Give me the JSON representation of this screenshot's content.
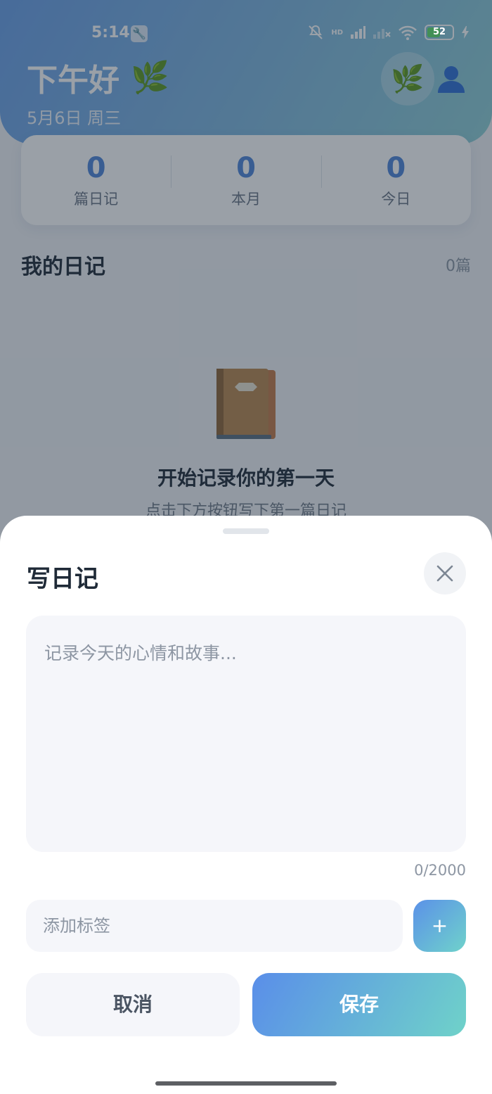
{
  "status_bar": {
    "time": "5:14",
    "hd_label": "HD",
    "battery": "52",
    "icons": [
      "wrench-icon",
      "mute-icon",
      "signal-icon",
      "no-signal-icon",
      "wifi-icon",
      "battery-icon",
      "charging-icon"
    ]
  },
  "header": {
    "greeting": "下午好",
    "greeting_emoji": "🌿",
    "date": "5月6日 周三",
    "leaf_button_emoji": "🌿",
    "profile_icon": "person-icon"
  },
  "stats": [
    {
      "value": "0",
      "label": "篇日记"
    },
    {
      "value": "0",
      "label": "本月"
    },
    {
      "value": "0",
      "label": "今日"
    }
  ],
  "diary_list": {
    "title": "我的日记",
    "count": "0篇",
    "empty_title": "开始记录你的第一天",
    "empty_subtitle": "点击下方按钮写下第一篇日记"
  },
  "sheet": {
    "title": "写日记",
    "textarea_placeholder": "记录今天的心情和故事...",
    "textarea_value": "",
    "char_count": "0/2000",
    "tag_placeholder": "添加标签",
    "tag_value": "",
    "add_tag_label": "+",
    "cancel_label": "取消",
    "save_label": "保存"
  },
  "colors": {
    "accent_blue": "#5b91e8",
    "accent_teal": "#6fd2cb",
    "stat_value": "#4f86d9"
  }
}
